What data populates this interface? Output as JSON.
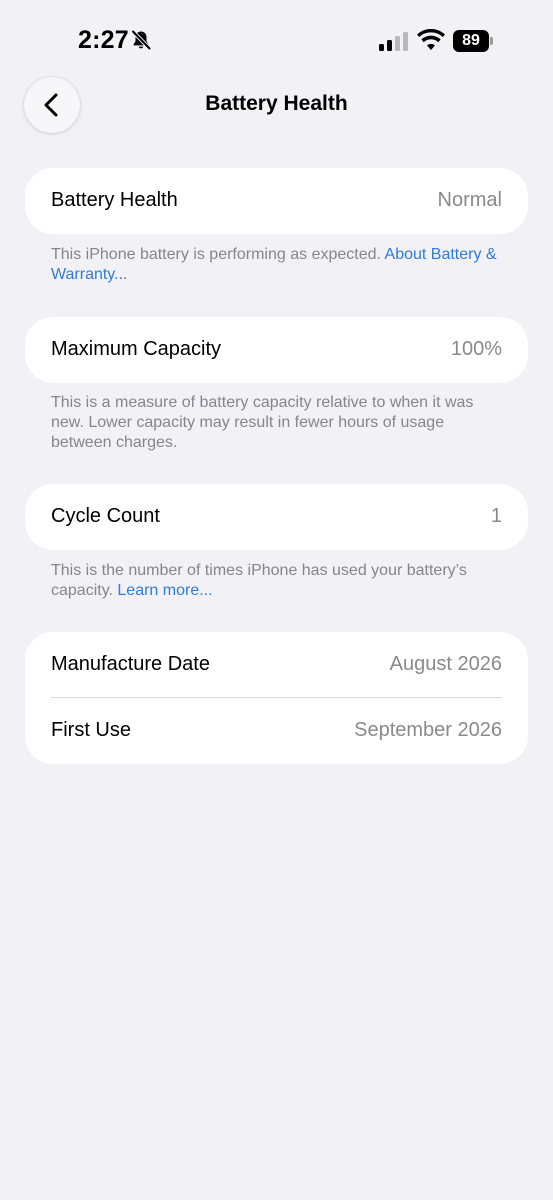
{
  "status_bar": {
    "time": "2:27",
    "battery_level": "89",
    "icons": [
      "bell-slash-icon",
      "cellular-signal-icon",
      "wifi-icon",
      "battery-icon"
    ]
  },
  "nav": {
    "title": "Battery Health",
    "back_icon": "chevron-left-icon"
  },
  "battery_health": {
    "label": "Battery Health",
    "value": "Normal",
    "footnote": "This iPhone battery is performing as expected. ",
    "footnote_link": "About Battery & Warranty..."
  },
  "maximum_capacity": {
    "label": "Maximum Capacity",
    "value": "100%",
    "footnote": "This is a measure of battery capacity relative to when it was new. Lower capacity may result in fewer hours of usage between charges."
  },
  "cycle_count": {
    "label": "Cycle Count",
    "value": "1",
    "footnote": "This is the number of times iPhone has used your battery’s capacity. ",
    "footnote_link": "Learn more..."
  },
  "dates": {
    "manufacture_label": "Manufacture Date",
    "manufacture_value": "August 2026",
    "first_use_label": "First Use",
    "first_use_value": "September 2026"
  },
  "colors": {
    "background": "#f2f1f6",
    "card": "#ffffff",
    "link": "#2f7bd9",
    "secondary_text": "#8a8a8e"
  }
}
